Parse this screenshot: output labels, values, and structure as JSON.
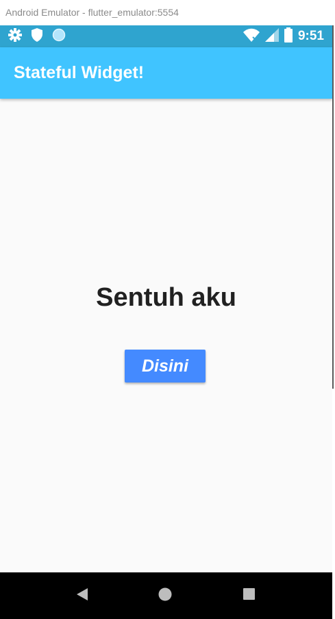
{
  "window": {
    "title": "Android Emulator - flutter_emulator:5554"
  },
  "status_bar": {
    "time": "9:51",
    "left_icons": [
      "gear-icon",
      "shield-icon",
      "circle-icon"
    ],
    "right_icons": [
      "wifi-icon",
      "signal-icon",
      "battery-icon"
    ],
    "color": "#2fa4cf"
  },
  "app_bar": {
    "title": "Stateful Widget!",
    "color": "#40c4ff"
  },
  "content": {
    "text": "Sentuh aku"
  },
  "button": {
    "label": "Disini",
    "color": "#448aff"
  },
  "nav_bar": {
    "buttons": [
      "back-icon",
      "home-icon",
      "recents-icon"
    ]
  }
}
